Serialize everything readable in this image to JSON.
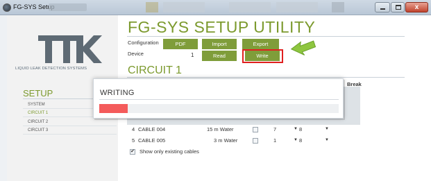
{
  "window": {
    "title": "FG-SYS Setup",
    "close_glyph": "x",
    "icons": [
      "app-icon",
      "minimize-icon",
      "maximize-icon",
      "close-icon"
    ]
  },
  "brand": {
    "logo_text": "TTK",
    "tagline": "LIQUID LEAK DETECTION SYSTEMS"
  },
  "sidebar": {
    "title": "SETUP",
    "items": [
      {
        "label": "SYSTEM",
        "active": false
      },
      {
        "label": "CIRCUIT 1",
        "active": true
      },
      {
        "label": "CIRCUIT 2",
        "active": false
      },
      {
        "label": "CIRCUIT 3",
        "active": false
      }
    ]
  },
  "main": {
    "title": "FG-SYS SETUP UTILITY",
    "configuration_label": "Configuration",
    "device_label": "Device",
    "device_value": "1",
    "buttons": {
      "pdf": "PDF",
      "import": "Import",
      "export": "Export",
      "read": "Read",
      "write": "Write"
    },
    "circuit_title": "CIRCUIT 1",
    "break_header": "Break"
  },
  "cables": [
    {
      "num": "4",
      "name": "CABLE 004",
      "length": "15 m",
      "type": "Water",
      "id": "7",
      "val": "8"
    },
    {
      "num": "5",
      "name": "CABLE 005",
      "length": "3 m",
      "type": "Water",
      "id": "1",
      "val": "8"
    }
  ],
  "dropdown_arrow": "▼",
  "show_only_existing": {
    "label": "Show only existing cables",
    "checked": true,
    "glyph": "✔"
  },
  "modal": {
    "title": "WRITING",
    "progress": 0.12
  },
  "colors": {
    "accent": "#7f9d3a",
    "progress": "#f45b5b",
    "highlight": "#e02020"
  }
}
